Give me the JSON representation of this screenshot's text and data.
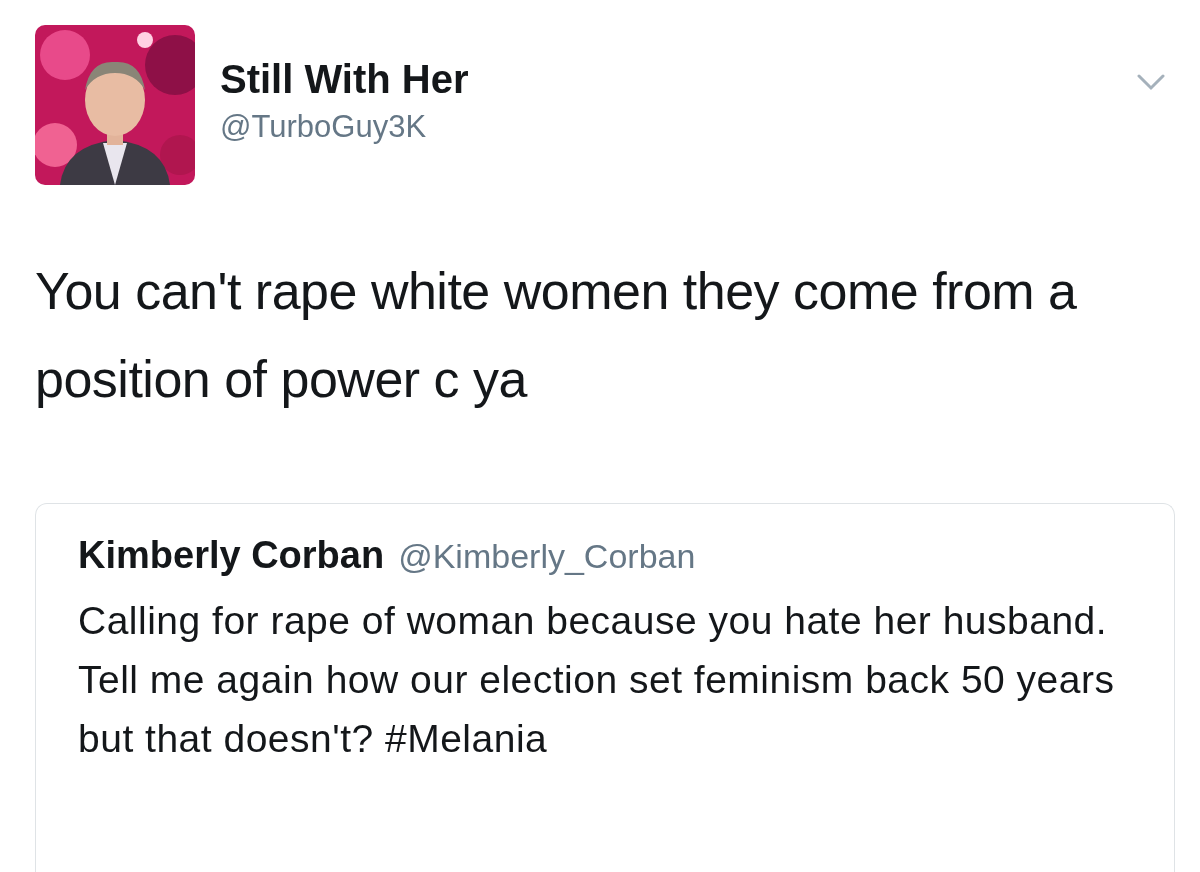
{
  "tweet": {
    "author": {
      "name": "Still With Her",
      "handle": "@TurboGuy3K"
    },
    "text": "You can't rape white women they come from a position of power c ya",
    "quoted_tweet": {
      "author": {
        "name": "Kimberly Corban",
        "handle": "@Kimberly_Corban"
      },
      "text": "Calling for rape of woman because you hate her husband. Tell me again how our election set feminism back 50 years but that doesn't? #Melania"
    }
  }
}
